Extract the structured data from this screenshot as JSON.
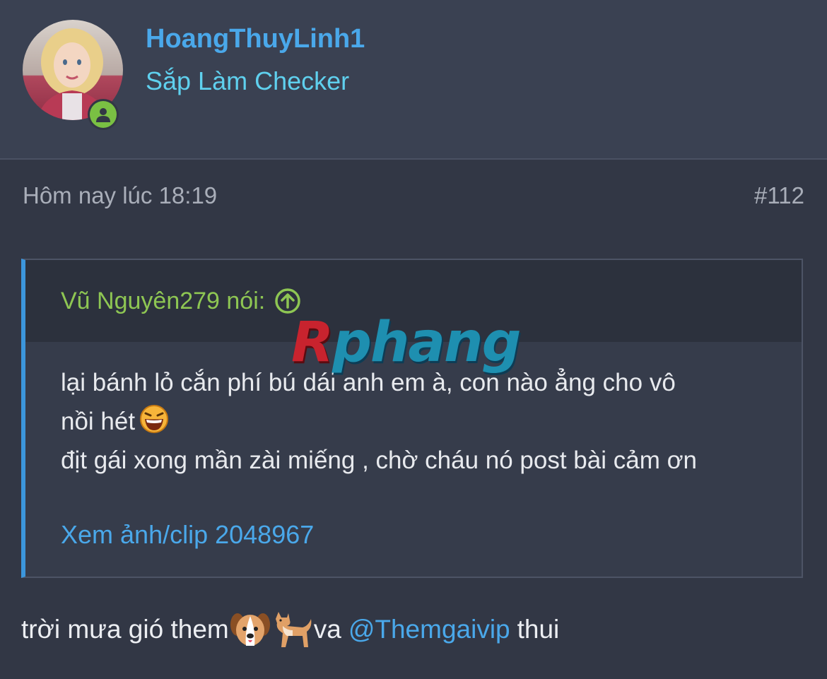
{
  "user": {
    "username": "HoangThuyLinh1",
    "title": "Sắp Làm Checker",
    "avatar_icon": "user-avatar",
    "online_icon": "online-user-icon"
  },
  "post": {
    "timestamp": "Hôm nay lúc 18:19",
    "number": "#112"
  },
  "quote": {
    "author": "Vũ Nguyên279 nói:",
    "jump_icon": "arrow-up-circle-icon",
    "lines": [
      "lại bánh lỏ cắn phí bú dái anh em à, con nào ẳng cho vô",
      "nồi hét",
      "địt gái xong mần zài miếng , chờ cháu nó post bài cảm ơn"
    ],
    "emoji": "laughing-emoji-icon",
    "link": "Xem ảnh/clip 2048967"
  },
  "watermark": {
    "first": "R",
    "rest": "phang"
  },
  "reply": {
    "text_before": "trời mưa gió them",
    "emoji_1": "dog-face-emoji-icon",
    "emoji_2": "dog-emoji-icon",
    "text_mid": "va",
    "mention": "@Themgaivip",
    "text_after": "thui"
  },
  "colors": {
    "background": "#323745",
    "header": "#3a4152",
    "link": "#4aa8ea",
    "title": "#5fd0ee",
    "quote_author": "#8ec653",
    "online": "#7ac043"
  }
}
